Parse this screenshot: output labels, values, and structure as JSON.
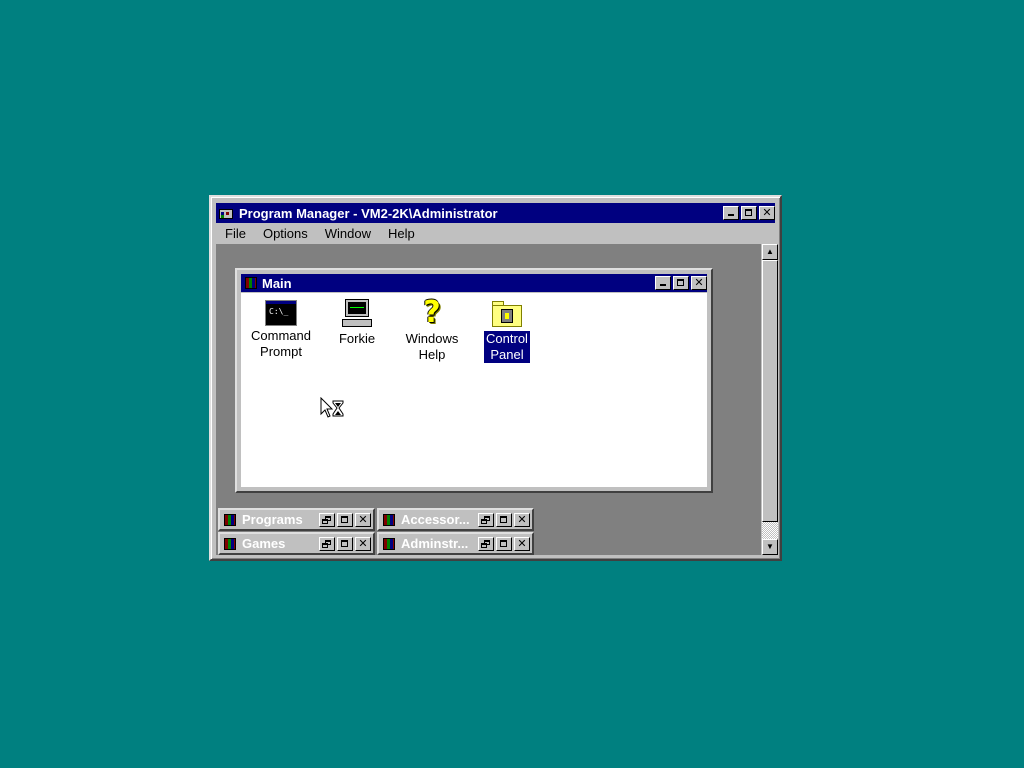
{
  "program_manager": {
    "title": "Program Manager - VM2-2K\\Administrator",
    "menu": [
      "File",
      "Options",
      "Window",
      "Help"
    ]
  },
  "main_group": {
    "title": "Main",
    "icons": [
      {
        "label": "Command\nPrompt",
        "icon": "command-prompt-icon",
        "selected": false
      },
      {
        "label": "Forkie",
        "icon": "computer-icon",
        "selected": false
      },
      {
        "label": "Windows\nHelp",
        "icon": "question-mark-icon",
        "selected": false
      },
      {
        "label": "Control\nPanel",
        "icon": "control-panel-icon",
        "selected": true
      }
    ],
    "cmd_glyph_text": "C:\\_"
  },
  "minimized_groups": [
    {
      "name": "Programs"
    },
    {
      "name": "Accessor..."
    },
    {
      "name": "Games"
    },
    {
      "name": "Adminstr..."
    }
  ],
  "colors": {
    "desktop": "#008080",
    "active_title": "#000080",
    "window_face": "#c0c0c0",
    "mdi_background": "#808080"
  },
  "cursor": "busy-arrow-hourglass"
}
